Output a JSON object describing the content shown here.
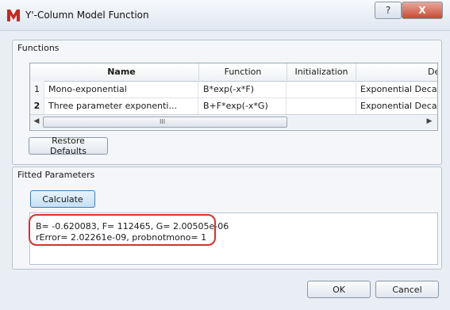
{
  "window": {
    "title": "Y'-Column Model Function",
    "help_glyph": "?",
    "close_glyph": "X"
  },
  "functions": {
    "group_title": "Functions",
    "columns": [
      "Name",
      "Function",
      "Initialization",
      "Descriptio"
    ],
    "rows": [
      {
        "num": "1",
        "name": "Mono-exponential",
        "function": "B*exp(-x*F)",
        "initialization": "",
        "description": "Exponential Decay (e.g"
      },
      {
        "num": "2",
        "name": "Three parameter exponenti...",
        "function": "B+F*exp(-x*G)",
        "initialization": "",
        "description": "Exponential Decay wit"
      }
    ],
    "scroll_grip": "III",
    "restore_label": "Restore Defaults"
  },
  "fitted": {
    "group_title": "Fitted Parameters",
    "calculate_label": "Calculate",
    "output_line_1": "B= -0.620083, F= 112465, G= 2.00505e-06",
    "output_line_2": "rError= 2.02261e-09, probnotmono= 1"
  },
  "footer": {
    "ok_label": "OK",
    "cancel_label": "Cancel"
  },
  "colors": {
    "highlight": "#d6312e",
    "app_icon": "#c8291f"
  }
}
